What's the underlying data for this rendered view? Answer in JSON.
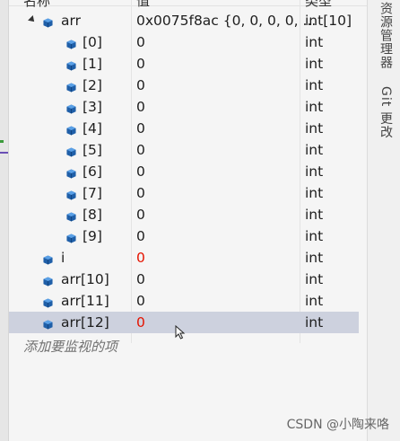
{
  "header": {
    "name_col": "名称",
    "value_col": "值",
    "type_col": "类型"
  },
  "rows": [
    {
      "name": "arr",
      "value": "0x0075f8ac {0, 0, 0, 0, ...",
      "type": "int[10]",
      "value_color": "normal",
      "expanded": true
    },
    {
      "name": "[0]",
      "value": "0",
      "type": "int",
      "value_color": "normal"
    },
    {
      "name": "[1]",
      "value": "0",
      "type": "int",
      "value_color": "normal"
    },
    {
      "name": "[2]",
      "value": "0",
      "type": "int",
      "value_color": "normal"
    },
    {
      "name": "[3]",
      "value": "0",
      "type": "int",
      "value_color": "normal"
    },
    {
      "name": "[4]",
      "value": "0",
      "type": "int",
      "value_color": "normal"
    },
    {
      "name": "[5]",
      "value": "0",
      "type": "int",
      "value_color": "normal"
    },
    {
      "name": "[6]",
      "value": "0",
      "type": "int",
      "value_color": "normal"
    },
    {
      "name": "[7]",
      "value": "0",
      "type": "int",
      "value_color": "normal"
    },
    {
      "name": "[8]",
      "value": "0",
      "type": "int",
      "value_color": "normal"
    },
    {
      "name": "[9]",
      "value": "0",
      "type": "int",
      "value_color": "normal"
    },
    {
      "name": "i",
      "value": "0",
      "type": "int",
      "value_color": "changed"
    },
    {
      "name": "arr[10]",
      "value": "0",
      "type": "int",
      "value_color": "normal"
    },
    {
      "name": "arr[11]",
      "value": "0",
      "type": "int",
      "value_color": "normal"
    },
    {
      "name": "arr[12]",
      "value": "0",
      "type": "int",
      "value_color": "changed",
      "selected": true
    }
  ],
  "add_watch_placeholder": "添加要监视的项",
  "right_tabs": {
    "tab1": "资源管理器",
    "tab2": "Git 更改"
  },
  "watermark": "CSDN @小陶来咯",
  "colors": {
    "changed_value": "#e51400",
    "selected_row": "#cdd1de",
    "cube_icon": "#1f5fa8"
  },
  "icons": {
    "variable": "cube-icon",
    "expand": "expand-triangle-icon",
    "pointer": "mouse-cursor-icon"
  }
}
